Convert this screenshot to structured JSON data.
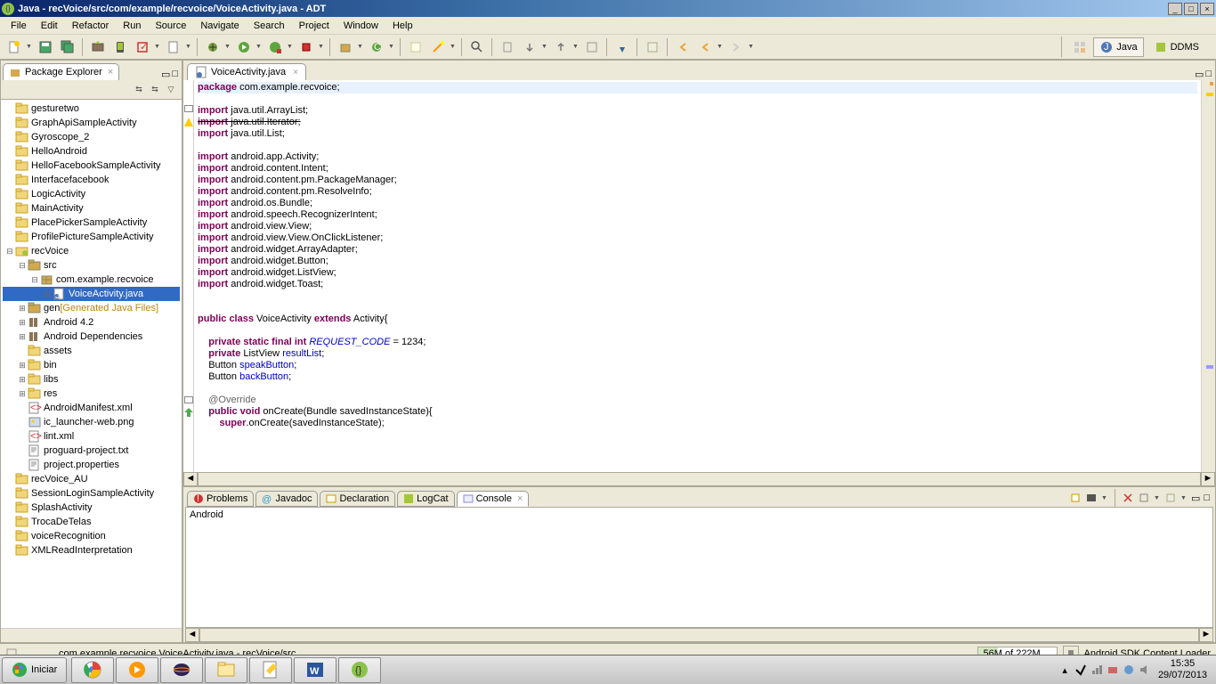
{
  "window": {
    "title": "Java - recVoice/src/com/example/recvoice/VoiceActivity.java - ADT",
    "min": "_",
    "max": "□",
    "close": "×"
  },
  "menu": [
    "File",
    "Edit",
    "Refactor",
    "Run",
    "Source",
    "Navigate",
    "Search",
    "Project",
    "Window",
    "Help"
  ],
  "perspectives": {
    "java": "Java",
    "ddms": "DDMS"
  },
  "explorer": {
    "title": "Package Explorer",
    "items": [
      {
        "lvl": 0,
        "exp": "",
        "kind": "folder",
        "label": "gesturetwo"
      },
      {
        "lvl": 0,
        "exp": "",
        "kind": "folder",
        "label": "GraphApiSampleActivity"
      },
      {
        "lvl": 0,
        "exp": "",
        "kind": "folder",
        "label": "Gyroscope_2"
      },
      {
        "lvl": 0,
        "exp": "",
        "kind": "folder",
        "label": "HelloAndroid"
      },
      {
        "lvl": 0,
        "exp": "",
        "kind": "folder",
        "label": "HelloFacebookSampleActivity"
      },
      {
        "lvl": 0,
        "exp": "",
        "kind": "folder",
        "label": "Interfacefacebook"
      },
      {
        "lvl": 0,
        "exp": "",
        "kind": "folder",
        "label": "LogicActivity"
      },
      {
        "lvl": 0,
        "exp": "",
        "kind": "folder",
        "label": "MainActivity"
      },
      {
        "lvl": 0,
        "exp": "",
        "kind": "folder",
        "label": "PlacePickerSampleActivity"
      },
      {
        "lvl": 0,
        "exp": "",
        "kind": "folder",
        "label": "ProfilePictureSampleActivity"
      },
      {
        "lvl": 0,
        "exp": "⊟",
        "kind": "project",
        "label": "recVoice"
      },
      {
        "lvl": 1,
        "exp": "⊟",
        "kind": "srcfolder",
        "label": "src"
      },
      {
        "lvl": 2,
        "exp": "⊟",
        "kind": "package",
        "label": "com.example.recvoice"
      },
      {
        "lvl": 3,
        "exp": "⊞",
        "kind": "java",
        "label": "VoiceActivity.java",
        "selected": true
      },
      {
        "lvl": 1,
        "exp": "⊞",
        "kind": "srcfolder",
        "label": "gen",
        "suffix": " [Generated Java Files]"
      },
      {
        "lvl": 1,
        "exp": "⊞",
        "kind": "lib",
        "label": "Android 4.2"
      },
      {
        "lvl": 1,
        "exp": "⊞",
        "kind": "lib",
        "label": "Android Dependencies"
      },
      {
        "lvl": 1,
        "exp": "",
        "kind": "folder",
        "label": "assets"
      },
      {
        "lvl": 1,
        "exp": "⊞",
        "kind": "folder",
        "label": "bin"
      },
      {
        "lvl": 1,
        "exp": "⊞",
        "kind": "folder",
        "label": "libs"
      },
      {
        "lvl": 1,
        "exp": "⊞",
        "kind": "folder",
        "label": "res"
      },
      {
        "lvl": 1,
        "exp": "",
        "kind": "xml",
        "label": "AndroidManifest.xml"
      },
      {
        "lvl": 1,
        "exp": "",
        "kind": "img",
        "label": "ic_launcher-web.png"
      },
      {
        "lvl": 1,
        "exp": "",
        "kind": "xml",
        "label": "lint.xml"
      },
      {
        "lvl": 1,
        "exp": "",
        "kind": "txt",
        "label": "proguard-project.txt"
      },
      {
        "lvl": 1,
        "exp": "",
        "kind": "txt",
        "label": "project.properties"
      },
      {
        "lvl": 0,
        "exp": "",
        "kind": "folder",
        "label": "recVoice_AU"
      },
      {
        "lvl": 0,
        "exp": "",
        "kind": "folder",
        "label": "SessionLoginSampleActivity"
      },
      {
        "lvl": 0,
        "exp": "",
        "kind": "folder",
        "label": "SplashActivity"
      },
      {
        "lvl": 0,
        "exp": "",
        "kind": "folder",
        "label": "TrocaDeTelas"
      },
      {
        "lvl": 0,
        "exp": "",
        "kind": "folder",
        "label": "voiceRecognition"
      },
      {
        "lvl": 0,
        "exp": "",
        "kind": "folder",
        "label": "XMLReadInterpretation"
      }
    ]
  },
  "editor": {
    "tab": "VoiceActivity.java",
    "code_lines": [
      {
        "t": "<kw>package</kw> com.example.recvoice;",
        "hl": true
      },
      {
        "t": ""
      },
      {
        "t": "<kw>import</kw> java.util.ArrayList;"
      },
      {
        "t": "<kw>import</kw> java.util.Iterator;",
        "strike": true
      },
      {
        "t": "<kw>import</kw> java.util.List;"
      },
      {
        "t": ""
      },
      {
        "t": "<kw>import</kw> android.app.Activity;"
      },
      {
        "t": "<kw>import</kw> android.content.Intent;"
      },
      {
        "t": "<kw>import</kw> android.content.pm.PackageManager;"
      },
      {
        "t": "<kw>import</kw> android.content.pm.ResolveInfo;"
      },
      {
        "t": "<kw>import</kw> android.os.Bundle;"
      },
      {
        "t": "<kw>import</kw> android.speech.RecognizerIntent;"
      },
      {
        "t": "<kw>import</kw> android.view.View;"
      },
      {
        "t": "<kw>import</kw> android.view.View.OnClickListener;"
      },
      {
        "t": "<kw>import</kw> android.widget.ArrayAdapter;"
      },
      {
        "t": "<kw>import</kw> android.widget.Button;"
      },
      {
        "t": "<kw>import</kw> android.widget.ListView;"
      },
      {
        "t": "<kw>import</kw> android.widget.Toast;"
      },
      {
        "t": ""
      },
      {
        "t": ""
      },
      {
        "t": "<kw>public class</kw> VoiceActivity <kw>extends</kw> Activity{"
      },
      {
        "t": ""
      },
      {
        "t": "    <kw>private static final int</kw> <sfld>REQUEST_CODE</sfld> = 1234;"
      },
      {
        "t": "    <kw>private</kw> ListView <fld>resultList</fld>;"
      },
      {
        "t": "    Button <fld>speakButton</fld>;"
      },
      {
        "t": "    Button <fld>backButton</fld>;"
      },
      {
        "t": ""
      },
      {
        "t": "    <ann>@Override</ann>"
      },
      {
        "t": "    <kw>public void</kw> onCreate(Bundle savedInstanceState){"
      },
      {
        "t": "        <kw>super</kw>.onCreate(savedInstanceState);"
      }
    ]
  },
  "bottom": {
    "tabs": [
      "Problems",
      "Javadoc",
      "Declaration",
      "LogCat",
      "Console"
    ],
    "active": 4,
    "console_text": "Android"
  },
  "status": {
    "path": "com.example.recvoice.VoiceActivity.java - recVoice/src",
    "heap": "56M of 222M",
    "progress": "Android SDK Content Loader"
  },
  "taskbar": {
    "start": "Iniciar",
    "time": "15:35",
    "date": "29/07/2013"
  }
}
